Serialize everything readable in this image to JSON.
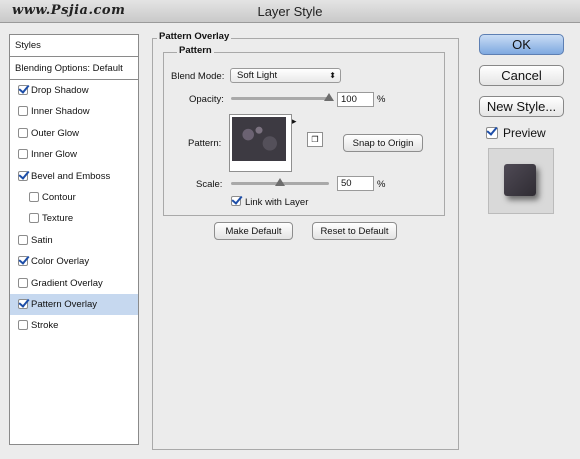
{
  "window": {
    "title": "Layer Style",
    "watermark": "www.Psjia.com"
  },
  "sidebar": {
    "header": "Styles",
    "blending": "Blending Options: Default",
    "items": [
      {
        "label": "Drop Shadow",
        "checked": true
      },
      {
        "label": "Inner Shadow",
        "checked": false
      },
      {
        "label": "Outer Glow",
        "checked": false
      },
      {
        "label": "Inner Glow",
        "checked": false
      },
      {
        "label": "Bevel and Emboss",
        "checked": true
      },
      {
        "label": "Contour",
        "checked": false
      },
      {
        "label": "Texture",
        "checked": false
      },
      {
        "label": "Satin",
        "checked": false
      },
      {
        "label": "Color Overlay",
        "checked": true
      },
      {
        "label": "Gradient Overlay",
        "checked": false
      },
      {
        "label": "Pattern Overlay",
        "checked": true,
        "selected": true
      },
      {
        "label": "Stroke",
        "checked": false
      }
    ]
  },
  "panel": {
    "section_title": "Pattern Overlay",
    "group_title": "Pattern",
    "blend_mode_label": "Blend Mode:",
    "blend_mode_value": "Soft Light",
    "opacity_label": "Opacity:",
    "opacity_value": "100",
    "opacity_unit": "%",
    "opacity_level": 1.0,
    "pattern_label": "Pattern:",
    "snap_button": "Snap to Origin",
    "scale_label": "Scale:",
    "scale_value": "50",
    "scale_unit": "%",
    "scale_level": 0.5,
    "link_label": "Link with Layer",
    "link_checked": true,
    "make_default": "Make Default",
    "reset_default": "Reset to Default"
  },
  "actions": {
    "ok": "OK",
    "cancel": "Cancel",
    "new_style": "New Style...",
    "preview_label": "Preview",
    "preview_checked": true
  },
  "colors": {
    "selected_row": "#c6d8ef",
    "primary_button": "#7fa9e0",
    "check": "#1d4ea8"
  }
}
